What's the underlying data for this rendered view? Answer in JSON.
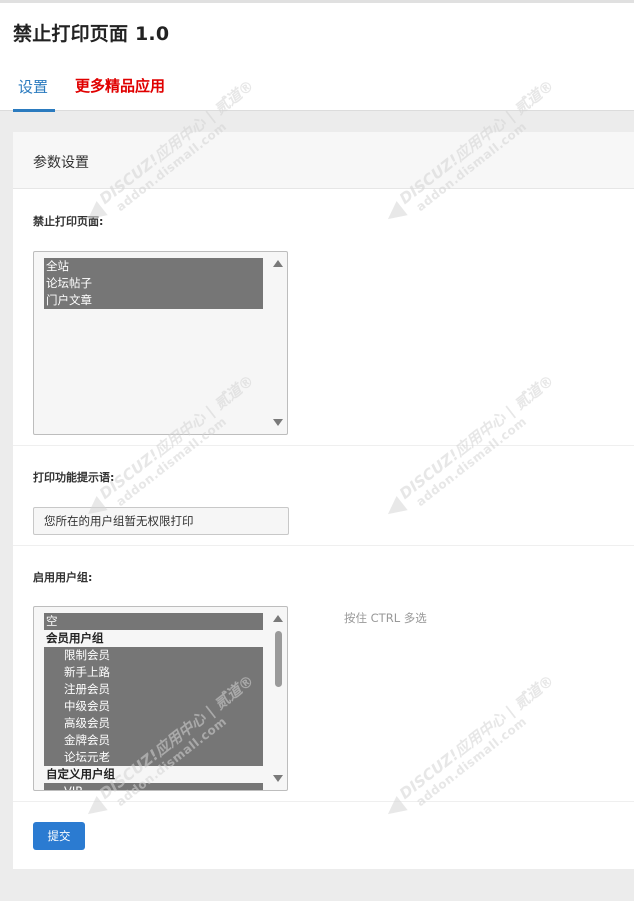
{
  "app": {
    "title": "禁止打印页面 1.0"
  },
  "tabs": [
    {
      "label": "设置",
      "active": true,
      "color": "#2b7bbf"
    },
    {
      "label": "更多精品应用",
      "active": false,
      "color": "#e00000"
    }
  ],
  "panel": {
    "title": "参数设置",
    "forbid_print": {
      "label": "禁止打印页面:",
      "options": [
        {
          "label": "全站",
          "selected": true
        },
        {
          "label": "论坛帖子",
          "selected": true
        },
        {
          "label": "门户文章",
          "selected": true
        }
      ]
    },
    "print_tip": {
      "label": "打印功能提示语:",
      "value": "您所在的用户组暂无权限打印"
    },
    "user_groups": {
      "label": "启用用户组:",
      "hint": "按住 CTRL 多选",
      "empty_option": "空",
      "group_member": "会员用户组",
      "member_options": [
        "限制会员",
        "新手上路",
        "注册会员",
        "中级会员",
        "高级会员",
        "金牌会员",
        "论坛元老"
      ],
      "group_custom": "自定义用户组",
      "custom_options": [
        "VIP"
      ]
    },
    "submit_label": "提交"
  },
  "watermark": {
    "brand": "DISCUZ!应用中心 | 贰道®",
    "domain": "addon.dismall.com"
  },
  "colors": {
    "accent": "#2b7bbf",
    "promo": "#e00000",
    "button": "#2b7bd1",
    "selection": "#767676"
  }
}
